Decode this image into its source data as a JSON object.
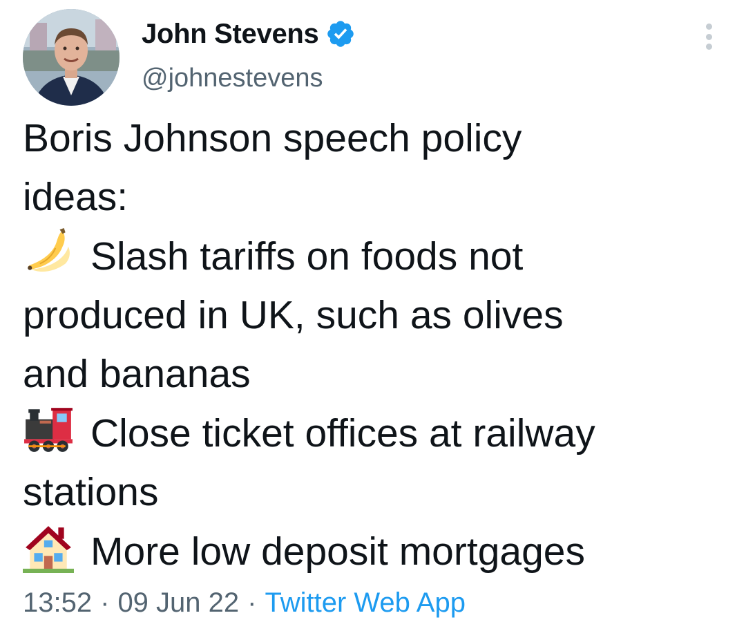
{
  "author": {
    "name": "John Stevens",
    "handle": "@johnestevens",
    "verified": true
  },
  "tweet": {
    "intro": [
      "Boris Johnson speech policy",
      "ideas:"
    ],
    "items": [
      {
        "icon": "banana-icon",
        "lines": [
          "Slash tariffs on foods not",
          "produced in UK, such as olives",
          "and bananas"
        ]
      },
      {
        "icon": "locomotive-icon",
        "lines": [
          "Close ticket offices at railway",
          "stations"
        ]
      },
      {
        "icon": "house-icon",
        "lines": [
          "More low deposit mortgages"
        ]
      }
    ]
  },
  "meta": {
    "time": "13:52",
    "separator": "·",
    "date": "09 Jun 22",
    "source": "Twitter Web App"
  },
  "colors": {
    "text": "#0f1419",
    "secondary": "#536471",
    "accent": "#1d9bf0"
  }
}
